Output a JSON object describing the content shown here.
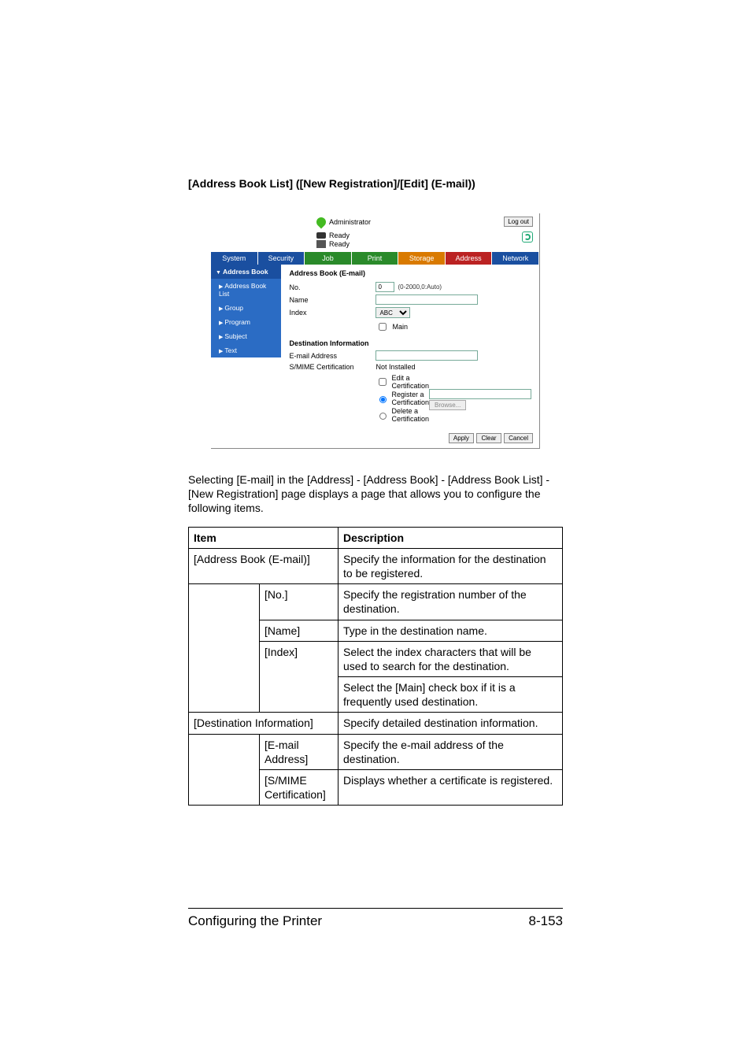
{
  "section_title": "[Address Book List] ([New Registration]/[Edit] (E-mail))",
  "shot": {
    "admin_label": "Administrator",
    "logout": "Log out",
    "status1": "Ready",
    "status2": "Ready",
    "tabs": [
      "System",
      "Security",
      "Job",
      "Print",
      "Storage",
      "Address",
      "Network"
    ],
    "sidebar": {
      "head": "Address Book",
      "list": "Address Book List",
      "group": "Group",
      "program": "Program",
      "subject": "Subject",
      "text": "Text"
    },
    "form": {
      "title": "Address Book (E-mail)",
      "no_label": "No.",
      "no_value": "0",
      "no_hint": "(0-2000,0:Auto)",
      "name_label": "Name",
      "index_label": "Index",
      "index_select": "ABC",
      "main_chk": "Main",
      "dest_head": "Destination Information",
      "email_label": "E-mail Address",
      "smime_label": "S/MIME Certification",
      "smime_value": "Not Installed",
      "edit_cert": "Edit a Certification",
      "reg_cert": "Register a Certification",
      "del_cert": "Delete a Certification",
      "browse": "Browse..."
    },
    "footer_btns": [
      "Apply",
      "Clear",
      "Cancel"
    ]
  },
  "paragraph": "Selecting [E-mail] in the [Address] - [Address Book] - [Address Book List] - [New Registration] page displays a page that allows you to configure the following items.",
  "table": {
    "h_item": "Item",
    "h_desc": "Description",
    "r1_item": "[Address Book (E-mail)]",
    "r1_desc": "Specify the information for the destination to be registered.",
    "r2_sub": "[No.]",
    "r2_desc": "Specify the registration number of the destination.",
    "r3_sub": "[Name]",
    "r3_desc": "Type in the destination name.",
    "r4_sub": "[Index]",
    "r4_desc_a": "Select the index characters that will be used to search for the destination.",
    "r4_desc_b": "Select the [Main] check box if it is a frequently used destination.",
    "r5_item": "[Destination Information]",
    "r5_desc": "Specify detailed destination information.",
    "r6_sub": "[E-mail Address]",
    "r6_desc": "Specify the e-mail address of the destination.",
    "r7_sub": "[S/MIME Certification]",
    "r7_desc": "Displays whether a certificate is registered."
  },
  "footer": {
    "left": "Configuring the Printer",
    "right": "8-153"
  }
}
